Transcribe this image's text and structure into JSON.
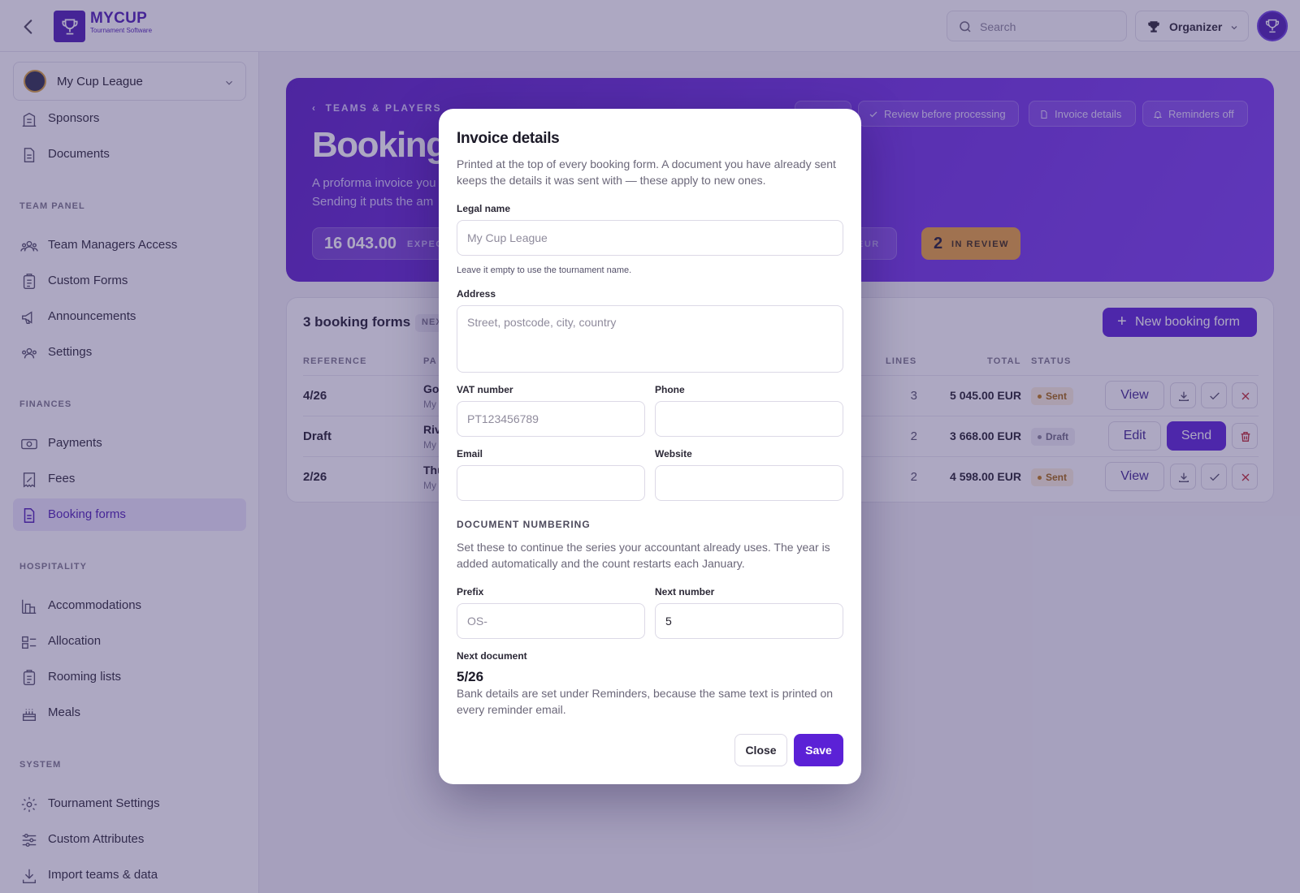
{
  "app": {
    "logo_title": "MYCUP",
    "logo_subtitle": "Tournament Software",
    "search_placeholder": "Search",
    "role": "Organizer"
  },
  "sidebar": {
    "league": "My Cup League",
    "items_top": [
      {
        "label": "Sponsors",
        "icon": "building-icon"
      },
      {
        "label": "Documents",
        "icon": "document-icon"
      }
    ],
    "sections": {
      "team_panel": "TEAM PANEL",
      "finances": "FINANCES",
      "hospitality": "HOSPITALITY",
      "system": "SYSTEM"
    },
    "team_panel": [
      {
        "label": "Team Managers Access"
      },
      {
        "label": "Custom Forms"
      },
      {
        "label": "Announcements"
      },
      {
        "label": "Settings"
      }
    ],
    "finances": [
      {
        "label": "Payments"
      },
      {
        "label": "Fees"
      },
      {
        "label": "Booking forms",
        "active": true
      }
    ],
    "hospitality": [
      {
        "label": "Accommodations"
      },
      {
        "label": "Allocation"
      },
      {
        "label": "Rooming lists"
      },
      {
        "label": "Meals"
      }
    ],
    "system": [
      {
        "label": "Tournament Settings"
      },
      {
        "label": "Custom Attributes"
      },
      {
        "label": "Import teams & data"
      }
    ]
  },
  "hero": {
    "breadcrumb": "TEAMS & PLAYERS",
    "title": "Booking",
    "desc_line1": "A proforma invoice you",
    "desc_line2": "Sending it puts the am",
    "stat_expected_value": "16 043.00",
    "stat_expected_label": "EXPEC",
    "stat_pending_label": "NG",
    "stat_pending_unit": "EUR",
    "stat_review_value": "2",
    "stat_review_label": "IN REVIEW",
    "pill_review": "Review before processing",
    "pill_invoice": "Invoice details",
    "pill_reminders": "Reminders off"
  },
  "table": {
    "title": "3 booking forms",
    "badge": "NEX",
    "new_button": "New booking form",
    "headers": {
      "reference": "REFERENCE",
      "party": "PA",
      "lines": "LINES",
      "total": "TOTAL",
      "status": "STATUS"
    },
    "rows": [
      {
        "ref": "4/26",
        "party": "Go",
        "party_sub": "My",
        "lines": "3",
        "total": "5 045.00 EUR",
        "status": "Sent",
        "action": "View"
      },
      {
        "ref": "Draft",
        "party": "Riv",
        "party_sub": "My",
        "lines": "2",
        "total": "3 668.00 EUR",
        "status": "Draft",
        "action": "Edit",
        "action2": "Send"
      },
      {
        "ref": "2/26",
        "party": "Thu",
        "party_sub": "My",
        "lines": "2",
        "total": "4 598.00 EUR",
        "status": "Sent",
        "action": "View"
      }
    ]
  },
  "modal": {
    "title": "Invoice details",
    "desc": "Printed at the top of every booking form. A document you have already sent keeps the details it was sent with — these apply to new ones.",
    "legal_name_label": "Legal name",
    "legal_name_placeholder": "My Cup League",
    "legal_name_hint": "Leave it empty to use the tournament name.",
    "address_label": "Address",
    "address_placeholder": "Street, postcode, city, country",
    "vat_label": "VAT number",
    "vat_placeholder": "PT123456789",
    "phone_label": "Phone",
    "email_label": "Email",
    "website_label": "Website",
    "numbering_section": "DOCUMENT NUMBERING",
    "numbering_desc": "Set these to continue the series your accountant already uses. The year is added automatically and the count restarts each January.",
    "prefix_label": "Prefix",
    "prefix_placeholder": "OS-",
    "next_number_label": "Next number",
    "next_number_value": "5",
    "next_document_label": "Next document",
    "next_document_value": "5/26",
    "bank_note": "Bank details are set under Reminders, because the same text is printed on every reminder email.",
    "close_label": "Close",
    "save_label": "Save"
  },
  "colors": {
    "brand": "#4c1db3",
    "accent": "#5b21d6",
    "review": "#e9a23b"
  }
}
